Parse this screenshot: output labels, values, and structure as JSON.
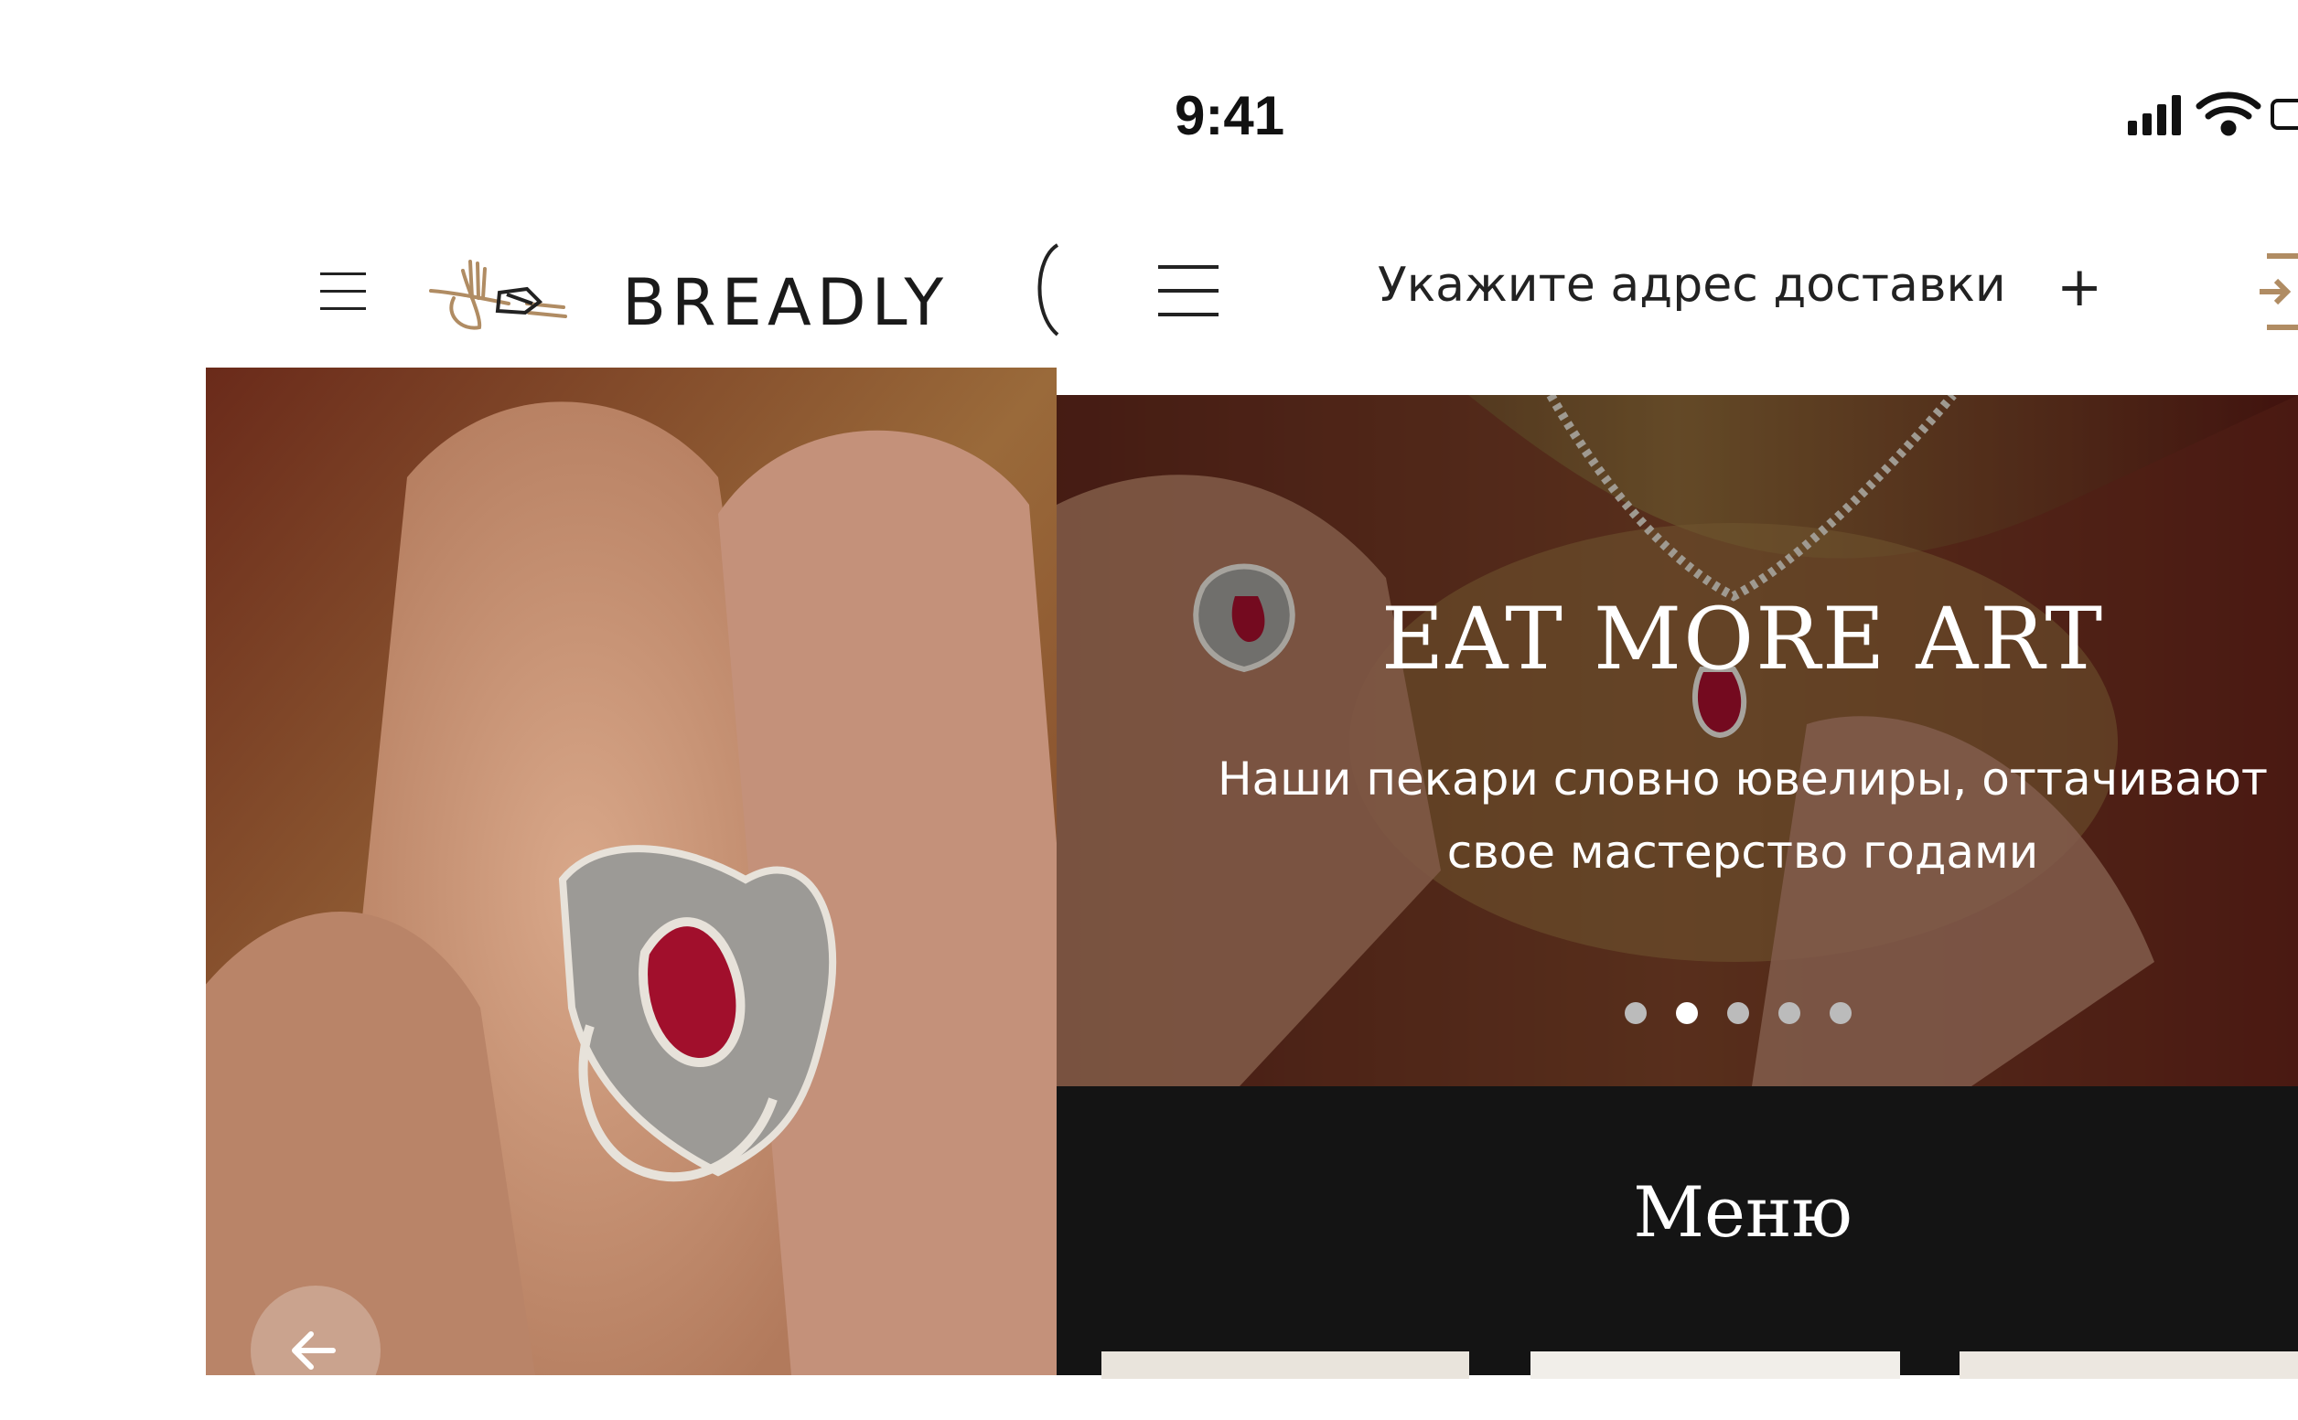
{
  "status_bar": {
    "time": "9:41"
  },
  "left_header": {
    "brand": "BREADLY",
    "icons": [
      "menu-icon",
      "brand-logo-icon"
    ]
  },
  "right_header": {
    "address_prompt": "Укажите адрес доставки",
    "plus": "+",
    "icons": [
      "menu-icon",
      "login-icon"
    ]
  },
  "hero": {
    "title": "EAT MORE ART",
    "subtitle_line1": "Наши пекари словно ювелиры, оттачивают",
    "subtitle_line2": "свое мастерство годами",
    "slides_total": 5,
    "active_slide": 2
  },
  "menu": {
    "title": "Меню"
  },
  "colors": {
    "accent_gold": "#b08c63",
    "dark_bg": "#141414"
  }
}
